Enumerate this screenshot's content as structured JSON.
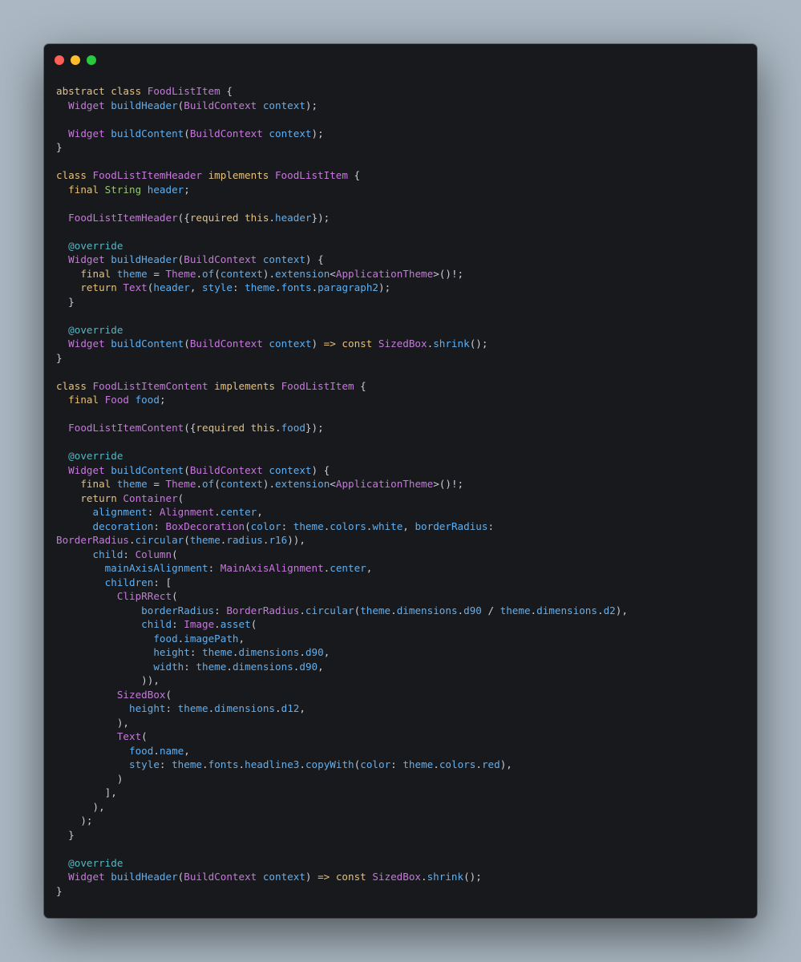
{
  "window": {
    "controls": [
      {
        "name": "close",
        "color": "#ff5f56"
      },
      {
        "name": "minimize",
        "color": "#ffbd2e"
      },
      {
        "name": "maximize",
        "color": "#27c93f"
      }
    ]
  },
  "theme": {
    "kw": "#e5c07b",
    "type": "#c678dd",
    "id": "#61afef",
    "ty2": "#98c379",
    "ann": "#56b6c2",
    "punc": "#c8ccd4"
  },
  "code_lines": [
    [
      [
        "kw",
        "abstract class "
      ],
      [
        "type",
        "FoodListItem"
      ],
      [
        "punc",
        " {"
      ]
    ],
    [
      [
        "punc",
        "  "
      ],
      [
        "type",
        "Widget "
      ],
      [
        "id",
        "buildHeader"
      ],
      [
        "punc",
        "("
      ],
      [
        "type",
        "BuildContext "
      ],
      [
        "id",
        "context"
      ],
      [
        "punc",
        ");"
      ]
    ],
    [],
    [
      [
        "punc",
        "  "
      ],
      [
        "type",
        "Widget "
      ],
      [
        "id",
        "buildContent"
      ],
      [
        "punc",
        "("
      ],
      [
        "type",
        "BuildContext "
      ],
      [
        "id",
        "context"
      ],
      [
        "punc",
        ");"
      ]
    ],
    [
      [
        "punc",
        "}"
      ]
    ],
    [],
    [
      [
        "kw",
        "class "
      ],
      [
        "type",
        "FoodListItemHeader "
      ],
      [
        "kw",
        "implements "
      ],
      [
        "type",
        "FoodListItem"
      ],
      [
        "punc",
        " {"
      ]
    ],
    [
      [
        "punc",
        "  "
      ],
      [
        "kw",
        "final "
      ],
      [
        "ty2",
        "String "
      ],
      [
        "id",
        "header"
      ],
      [
        "punc",
        ";"
      ]
    ],
    [],
    [
      [
        "punc",
        "  "
      ],
      [
        "type",
        "FoodListItemHeader"
      ],
      [
        "punc",
        "({"
      ],
      [
        "kw",
        "required this"
      ],
      [
        "punc",
        "."
      ],
      [
        "id",
        "header"
      ],
      [
        "punc",
        "});"
      ]
    ],
    [],
    [
      [
        "punc",
        "  "
      ],
      [
        "ann",
        "@override"
      ]
    ],
    [
      [
        "punc",
        "  "
      ],
      [
        "type",
        "Widget "
      ],
      [
        "id",
        "buildHeader"
      ],
      [
        "punc",
        "("
      ],
      [
        "type",
        "BuildContext "
      ],
      [
        "id",
        "context"
      ],
      [
        "punc",
        ") {"
      ]
    ],
    [
      [
        "punc",
        "    "
      ],
      [
        "kw",
        "final "
      ],
      [
        "id",
        "theme"
      ],
      [
        "punc",
        " = "
      ],
      [
        "type",
        "Theme"
      ],
      [
        "punc",
        "."
      ],
      [
        "id",
        "of"
      ],
      [
        "punc",
        "("
      ],
      [
        "id",
        "context"
      ],
      [
        "punc",
        ")."
      ],
      [
        "id",
        "extension"
      ],
      [
        "punc",
        "<"
      ],
      [
        "type",
        "ApplicationTheme"
      ],
      [
        "punc",
        ">()!;"
      ]
    ],
    [
      [
        "punc",
        "    "
      ],
      [
        "kw",
        "return "
      ],
      [
        "type",
        "Text"
      ],
      [
        "punc",
        "("
      ],
      [
        "id",
        "header"
      ],
      [
        "punc",
        ", "
      ],
      [
        "id",
        "style"
      ],
      [
        "punc",
        ": "
      ],
      [
        "id",
        "theme"
      ],
      [
        "punc",
        "."
      ],
      [
        "id",
        "fonts"
      ],
      [
        "punc",
        "."
      ],
      [
        "id",
        "paragraph2"
      ],
      [
        "punc",
        ");"
      ]
    ],
    [
      [
        "punc",
        "  }"
      ]
    ],
    [],
    [
      [
        "punc",
        "  "
      ],
      [
        "ann",
        "@override"
      ]
    ],
    [
      [
        "punc",
        "  "
      ],
      [
        "type",
        "Widget "
      ],
      [
        "id",
        "buildContent"
      ],
      [
        "punc",
        "("
      ],
      [
        "type",
        "BuildContext "
      ],
      [
        "id",
        "context"
      ],
      [
        "punc",
        ") "
      ],
      [
        "kw",
        "=> const "
      ],
      [
        "type",
        "SizedBox"
      ],
      [
        "punc",
        "."
      ],
      [
        "id",
        "shrink"
      ],
      [
        "punc",
        "();"
      ]
    ],
    [
      [
        "punc",
        "}"
      ]
    ],
    [],
    [
      [
        "kw",
        "class "
      ],
      [
        "type",
        "FoodListItemContent "
      ],
      [
        "kw",
        "implements "
      ],
      [
        "type",
        "FoodListItem"
      ],
      [
        "punc",
        " {"
      ]
    ],
    [
      [
        "punc",
        "  "
      ],
      [
        "kw",
        "final "
      ],
      [
        "type",
        "Food "
      ],
      [
        "id",
        "food"
      ],
      [
        "punc",
        ";"
      ]
    ],
    [],
    [
      [
        "punc",
        "  "
      ],
      [
        "type",
        "FoodListItemContent"
      ],
      [
        "punc",
        "({"
      ],
      [
        "kw",
        "required this"
      ],
      [
        "punc",
        "."
      ],
      [
        "id",
        "food"
      ],
      [
        "punc",
        "});"
      ]
    ],
    [],
    [
      [
        "punc",
        "  "
      ],
      [
        "ann",
        "@override"
      ]
    ],
    [
      [
        "punc",
        "  "
      ],
      [
        "type",
        "Widget "
      ],
      [
        "id",
        "buildContent"
      ],
      [
        "punc",
        "("
      ],
      [
        "type",
        "BuildContext "
      ],
      [
        "id",
        "context"
      ],
      [
        "punc",
        ") {"
      ]
    ],
    [
      [
        "punc",
        "    "
      ],
      [
        "kw",
        "final "
      ],
      [
        "id",
        "theme"
      ],
      [
        "punc",
        " = "
      ],
      [
        "type",
        "Theme"
      ],
      [
        "punc",
        "."
      ],
      [
        "id",
        "of"
      ],
      [
        "punc",
        "("
      ],
      [
        "id",
        "context"
      ],
      [
        "punc",
        ")."
      ],
      [
        "id",
        "extension"
      ],
      [
        "punc",
        "<"
      ],
      [
        "type",
        "ApplicationTheme"
      ],
      [
        "punc",
        ">()!;"
      ]
    ],
    [
      [
        "punc",
        "    "
      ],
      [
        "kw",
        "return "
      ],
      [
        "type",
        "Container"
      ],
      [
        "punc",
        "("
      ]
    ],
    [
      [
        "punc",
        "      "
      ],
      [
        "id",
        "alignment"
      ],
      [
        "punc",
        ": "
      ],
      [
        "type",
        "Alignment"
      ],
      [
        "punc",
        "."
      ],
      [
        "id",
        "center"
      ],
      [
        "punc",
        ","
      ]
    ],
    [
      [
        "punc",
        "      "
      ],
      [
        "id",
        "decoration"
      ],
      [
        "punc",
        ": "
      ],
      [
        "type",
        "BoxDecoration"
      ],
      [
        "punc",
        "("
      ],
      [
        "id",
        "color"
      ],
      [
        "punc",
        ": "
      ],
      [
        "id",
        "theme"
      ],
      [
        "punc",
        "."
      ],
      [
        "id",
        "colors"
      ],
      [
        "punc",
        "."
      ],
      [
        "id",
        "white"
      ],
      [
        "punc",
        ", "
      ],
      [
        "id",
        "borderRadius"
      ],
      [
        "punc",
        ":"
      ]
    ],
    [
      [
        "type",
        "BorderRadius"
      ],
      [
        "punc",
        "."
      ],
      [
        "id",
        "circular"
      ],
      [
        "punc",
        "("
      ],
      [
        "id",
        "theme"
      ],
      [
        "punc",
        "."
      ],
      [
        "id",
        "radius"
      ],
      [
        "punc",
        "."
      ],
      [
        "id",
        "r16"
      ],
      [
        "punc",
        ")),"
      ]
    ],
    [
      [
        "punc",
        "      "
      ],
      [
        "id",
        "child"
      ],
      [
        "punc",
        ": "
      ],
      [
        "type",
        "Column"
      ],
      [
        "punc",
        "("
      ]
    ],
    [
      [
        "punc",
        "        "
      ],
      [
        "id",
        "mainAxisAlignment"
      ],
      [
        "punc",
        ": "
      ],
      [
        "type",
        "MainAxisAlignment"
      ],
      [
        "punc",
        "."
      ],
      [
        "id",
        "center"
      ],
      [
        "punc",
        ","
      ]
    ],
    [
      [
        "punc",
        "        "
      ],
      [
        "id",
        "children"
      ],
      [
        "punc",
        ": ["
      ]
    ],
    [
      [
        "punc",
        "          "
      ],
      [
        "type",
        "ClipRRect"
      ],
      [
        "punc",
        "("
      ]
    ],
    [
      [
        "punc",
        "              "
      ],
      [
        "id",
        "borderRadius"
      ],
      [
        "punc",
        ": "
      ],
      [
        "type",
        "BorderRadius"
      ],
      [
        "punc",
        "."
      ],
      [
        "id",
        "circular"
      ],
      [
        "punc",
        "("
      ],
      [
        "id",
        "theme"
      ],
      [
        "punc",
        "."
      ],
      [
        "id",
        "dimensions"
      ],
      [
        "punc",
        "."
      ],
      [
        "id",
        "d90"
      ],
      [
        "punc",
        " / "
      ],
      [
        "id",
        "theme"
      ],
      [
        "punc",
        "."
      ],
      [
        "id",
        "dimensions"
      ],
      [
        "punc",
        "."
      ],
      [
        "id",
        "d2"
      ],
      [
        "punc",
        "),"
      ]
    ],
    [
      [
        "punc",
        "              "
      ],
      [
        "id",
        "child"
      ],
      [
        "punc",
        ": "
      ],
      [
        "type",
        "Image"
      ],
      [
        "punc",
        "."
      ],
      [
        "id",
        "asset"
      ],
      [
        "punc",
        "("
      ]
    ],
    [
      [
        "punc",
        "                "
      ],
      [
        "id",
        "food"
      ],
      [
        "punc",
        "."
      ],
      [
        "id",
        "imagePath"
      ],
      [
        "punc",
        ","
      ]
    ],
    [
      [
        "punc",
        "                "
      ],
      [
        "id",
        "height"
      ],
      [
        "punc",
        ": "
      ],
      [
        "id",
        "theme"
      ],
      [
        "punc",
        "."
      ],
      [
        "id",
        "dimensions"
      ],
      [
        "punc",
        "."
      ],
      [
        "id",
        "d90"
      ],
      [
        "punc",
        ","
      ]
    ],
    [
      [
        "punc",
        "                "
      ],
      [
        "id",
        "width"
      ],
      [
        "punc",
        ": "
      ],
      [
        "id",
        "theme"
      ],
      [
        "punc",
        "."
      ],
      [
        "id",
        "dimensions"
      ],
      [
        "punc",
        "."
      ],
      [
        "id",
        "d90"
      ],
      [
        "punc",
        ","
      ]
    ],
    [
      [
        "punc",
        "              )),"
      ]
    ],
    [
      [
        "punc",
        "          "
      ],
      [
        "type",
        "SizedBox"
      ],
      [
        "punc",
        "("
      ]
    ],
    [
      [
        "punc",
        "            "
      ],
      [
        "id",
        "height"
      ],
      [
        "punc",
        ": "
      ],
      [
        "id",
        "theme"
      ],
      [
        "punc",
        "."
      ],
      [
        "id",
        "dimensions"
      ],
      [
        "punc",
        "."
      ],
      [
        "id",
        "d12"
      ],
      [
        "punc",
        ","
      ]
    ],
    [
      [
        "punc",
        "          ),"
      ]
    ],
    [
      [
        "punc",
        "          "
      ],
      [
        "type",
        "Text"
      ],
      [
        "punc",
        "("
      ]
    ],
    [
      [
        "punc",
        "            "
      ],
      [
        "id",
        "food"
      ],
      [
        "punc",
        "."
      ],
      [
        "id",
        "name"
      ],
      [
        "punc",
        ","
      ]
    ],
    [
      [
        "punc",
        "            "
      ],
      [
        "id",
        "style"
      ],
      [
        "punc",
        ": "
      ],
      [
        "id",
        "theme"
      ],
      [
        "punc",
        "."
      ],
      [
        "id",
        "fonts"
      ],
      [
        "punc",
        "."
      ],
      [
        "id",
        "headline3"
      ],
      [
        "punc",
        "."
      ],
      [
        "id",
        "copyWith"
      ],
      [
        "punc",
        "("
      ],
      [
        "id",
        "color"
      ],
      [
        "punc",
        ": "
      ],
      [
        "id",
        "theme"
      ],
      [
        "punc",
        "."
      ],
      [
        "id",
        "colors"
      ],
      [
        "punc",
        "."
      ],
      [
        "id",
        "red"
      ],
      [
        "punc",
        "),"
      ]
    ],
    [
      [
        "punc",
        "          )"
      ]
    ],
    [
      [
        "punc",
        "        ],"
      ]
    ],
    [
      [
        "punc",
        "      ),"
      ]
    ],
    [
      [
        "punc",
        "    );"
      ]
    ],
    [
      [
        "punc",
        "  }"
      ]
    ],
    [],
    [
      [
        "punc",
        "  "
      ],
      [
        "ann",
        "@override"
      ]
    ],
    [
      [
        "punc",
        "  "
      ],
      [
        "type",
        "Widget "
      ],
      [
        "id",
        "buildHeader"
      ],
      [
        "punc",
        "("
      ],
      [
        "type",
        "BuildContext "
      ],
      [
        "id",
        "context"
      ],
      [
        "punc",
        ") "
      ],
      [
        "kw",
        "=> const "
      ],
      [
        "type",
        "SizedBox"
      ],
      [
        "punc",
        "."
      ],
      [
        "id",
        "shrink"
      ],
      [
        "punc",
        "();"
      ]
    ],
    [
      [
        "punc",
        "}"
      ]
    ]
  ]
}
